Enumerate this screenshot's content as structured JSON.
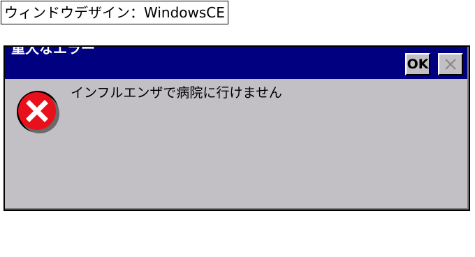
{
  "page_label": "ウィンドウデザイン：WindowsCE",
  "dialog": {
    "title": "重大なエラー",
    "ok_label": "OK",
    "close_label": "✕",
    "message": "インフルエンザで病院に行けません",
    "icon": "error-icon"
  },
  "colors": {
    "titlebar": "#000080",
    "face": "#c2c0c5",
    "icon_red": "#e8101b"
  }
}
